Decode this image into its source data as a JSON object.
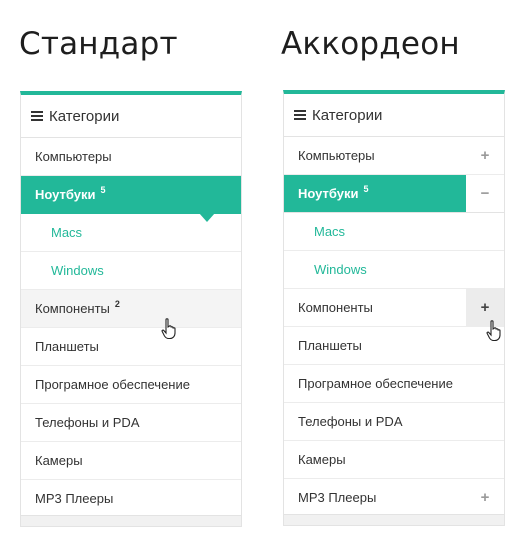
{
  "headings": {
    "standard": "Стандарт",
    "accordion": "Аккордеон"
  },
  "panel": {
    "title": "Категории"
  },
  "standard": {
    "items": [
      {
        "label": "Компьютеры"
      },
      {
        "label": "Ноутбуки",
        "badge": "5"
      },
      {
        "label": "Macs"
      },
      {
        "label": "Windows"
      },
      {
        "label": "Компоненты",
        "badge": "2"
      },
      {
        "label": "Планшеты"
      },
      {
        "label": "Програмное обеспечение"
      },
      {
        "label": "Телефоны и PDA"
      },
      {
        "label": "Камеры"
      },
      {
        "label": "MP3 Плееры"
      }
    ]
  },
  "accordion": {
    "items": [
      {
        "label": "Компьютеры",
        "toggle": "+"
      },
      {
        "label": "Ноутбуки",
        "badge": "5",
        "toggle": "−"
      },
      {
        "label": "Macs"
      },
      {
        "label": "Windows"
      },
      {
        "label": "Компоненты",
        "toggle": "+"
      },
      {
        "label": "Планшеты"
      },
      {
        "label": "Програмное обеспечение"
      },
      {
        "label": "Телефоны и PDA"
      },
      {
        "label": "Камеры"
      },
      {
        "label": "MP3 Плееры",
        "toggle": "+"
      }
    ]
  },
  "colors": {
    "accent": "#22b899",
    "hover": "#f4f4f4"
  }
}
